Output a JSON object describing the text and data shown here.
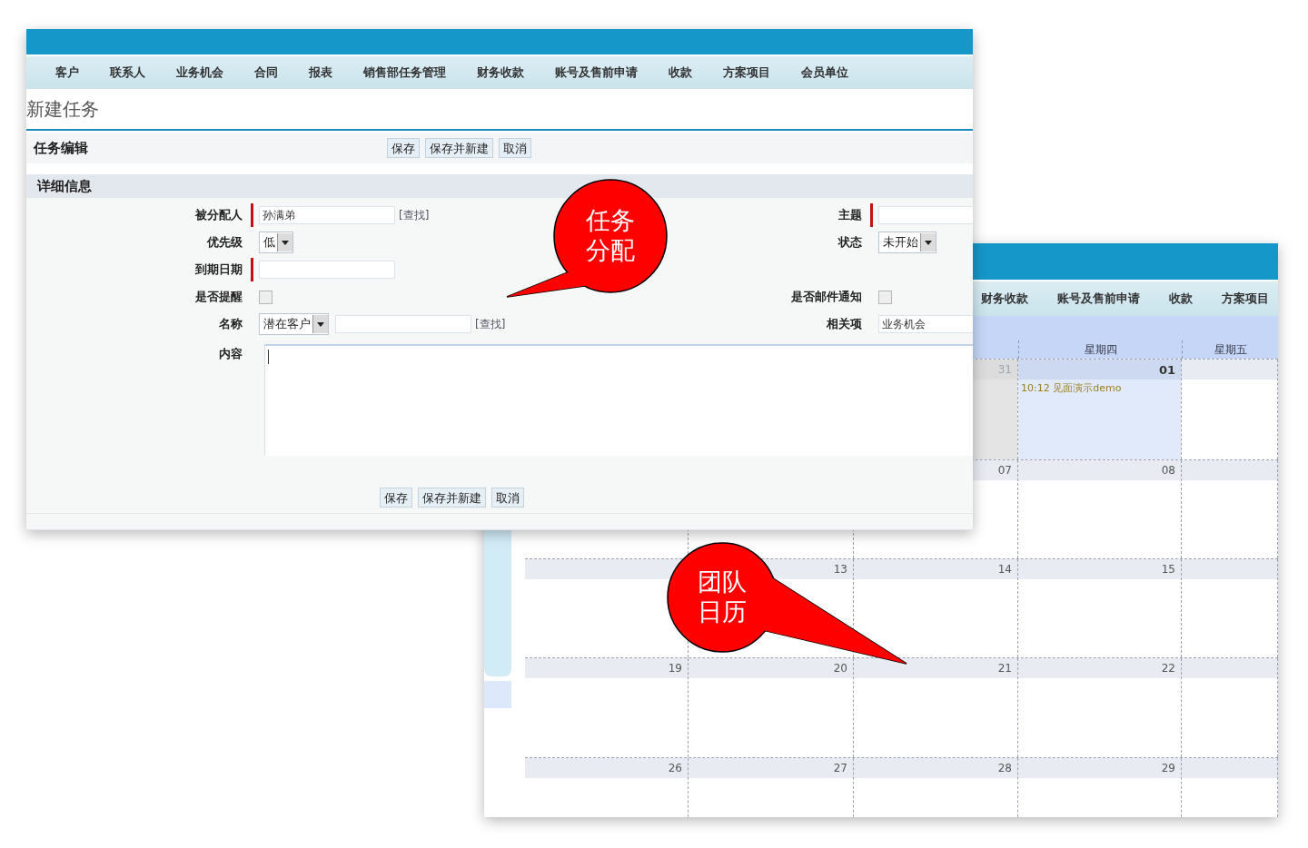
{
  "calendar_window": {
    "nav_items": [
      "财务收款",
      "账号及售前申请",
      "收款",
      "方案项目"
    ],
    "day_headers": [
      "星期四",
      "星期五"
    ],
    "weeks": [
      {
        "days": [
          {
            "date": "31",
            "today": false,
            "muted": true
          },
          {
            "date": "01",
            "today": true,
            "muted": false,
            "events": [
              "10:12 见面演示demo"
            ]
          }
        ]
      },
      {
        "days": [
          {
            "date": "07",
            "today": false,
            "muted": false
          },
          {
            "date": "08",
            "today": false,
            "muted": false
          }
        ]
      },
      {
        "days": [
          {
            "date": "13",
            "today": false,
            "muted": false
          },
          {
            "date": "14",
            "today": false,
            "muted": false
          },
          {
            "date": "15",
            "today": false,
            "muted": false
          }
        ]
      },
      {
        "days": [
          {
            "date": "19",
            "today": false,
            "muted": false
          },
          {
            "date": "20",
            "today": false,
            "muted": false
          },
          {
            "date": "21",
            "today": false,
            "muted": false
          },
          {
            "date": "22",
            "today": false,
            "muted": false
          }
        ]
      },
      {
        "days": [
          {
            "date": "26",
            "today": false,
            "muted": false
          },
          {
            "date": "27",
            "today": false,
            "muted": false
          },
          {
            "date": "28",
            "today": false,
            "muted": false
          },
          {
            "date": "29",
            "today": false,
            "muted": false
          }
        ]
      }
    ]
  },
  "task_window": {
    "nav_items": [
      "客户",
      "联系人",
      "业务机会",
      "合同",
      "报表",
      "销售部任务管理",
      "财务收款",
      "账号及售前申请",
      "收款",
      "方案项目",
      "会员单位"
    ],
    "title": "新建任务",
    "section": "任务编辑",
    "buttons": [
      "保存",
      "保存并新建",
      "取消"
    ],
    "detail_heading": "详细信息",
    "rows": [
      {
        "left": {
          "label": "被分配人",
          "kind": "text",
          "required": true,
          "value": "孙满弟",
          "link": "[查找]"
        },
        "right": {
          "label": "主题",
          "kind": "text",
          "required": true
        }
      },
      {
        "left": {
          "label": "优先级",
          "kind": "select",
          "required": false,
          "value": "低"
        },
        "right": {
          "label": "状态",
          "kind": "select",
          "required": false,
          "value": "未开始"
        }
      },
      {
        "left": {
          "label": "到期日期",
          "kind": "text",
          "required": true
        }
      },
      {
        "left": {
          "label": "是否提醒",
          "kind": "checkbox",
          "required": false,
          "checked": false
        },
        "right": {
          "label": "是否邮件通知",
          "kind": "checkbox",
          "required": false,
          "checked": false
        }
      },
      {
        "left": {
          "label": "名称",
          "kind": "select_text",
          "required": false,
          "value": "潜在客户",
          "link": "[查找]"
        },
        "right": {
          "label": "相关项",
          "kind": "text",
          "required": false,
          "value": "业务机会"
        }
      },
      {
        "left": {
          "label": "内容",
          "kind": "textarea",
          "required": false
        }
      }
    ],
    "bottom_buttons": [
      "保存",
      "保存并新建",
      "取消"
    ]
  },
  "callouts": [
    {
      "text": "任务分配"
    },
    {
      "text": "团队日历"
    }
  ]
}
